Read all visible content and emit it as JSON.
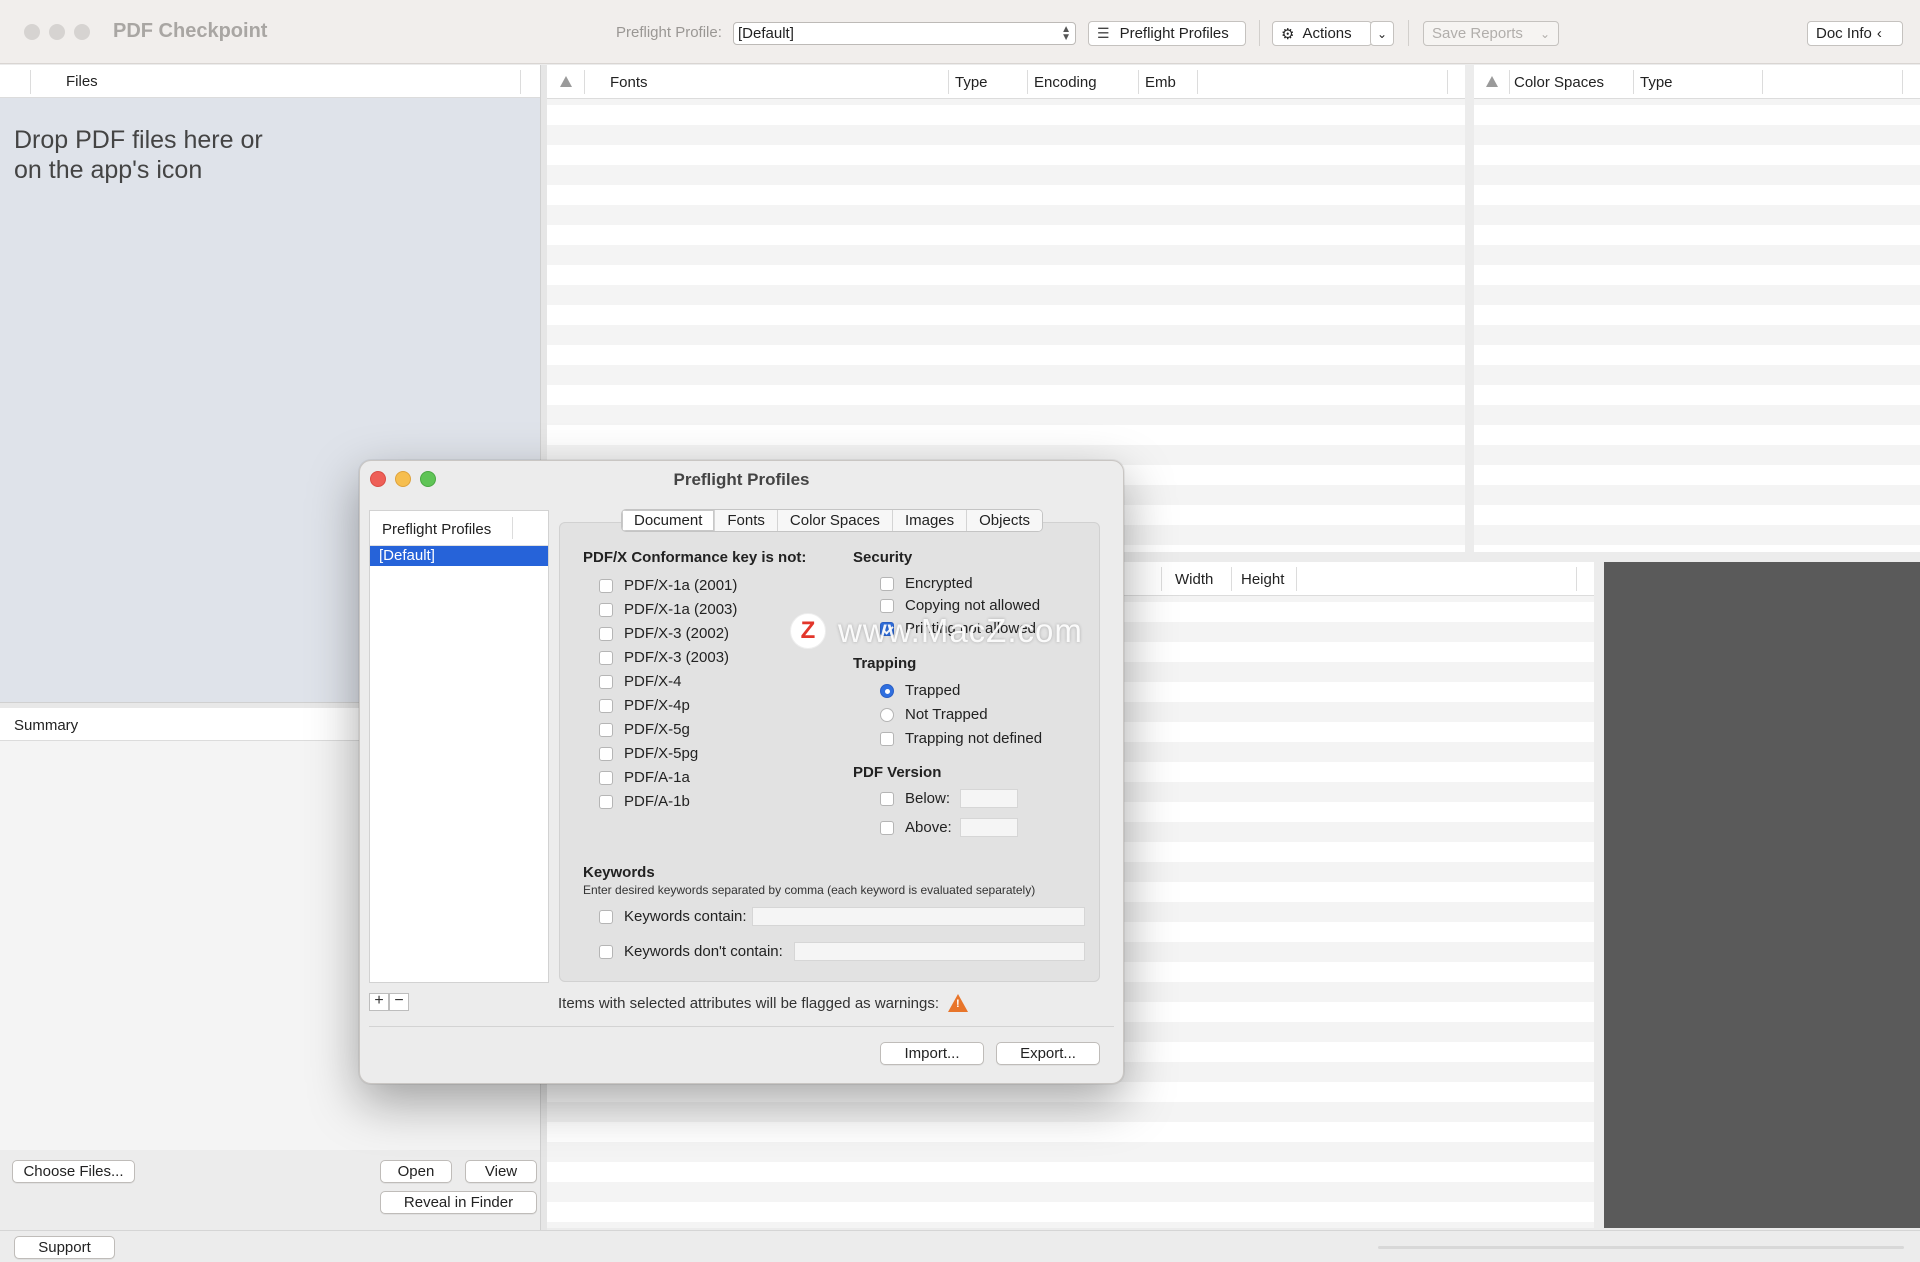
{
  "app": {
    "title": "PDF Checkpoint"
  },
  "toolbar": {
    "profile_label": "Preflight Profile:",
    "profile_value": "[Default]",
    "preflight_profiles_label": "Preflight Profiles",
    "actions_label": "Actions",
    "save_reports_label": "Save Reports",
    "doc_info_label": "Doc Info"
  },
  "files": {
    "header": "Files",
    "drop_line1": "Drop PDF files here or",
    "drop_line2": "on the app's icon"
  },
  "summary": {
    "header": "Summary"
  },
  "left_buttons": {
    "choose_files": "Choose Files...",
    "open": "Open",
    "view": "View",
    "reveal": "Reveal in Finder"
  },
  "fonts_table": {
    "columns": [
      "Fonts",
      "Type",
      "Encoding",
      "Emb"
    ]
  },
  "color_table": {
    "columns": [
      "Color Spaces",
      "Type"
    ]
  },
  "images_table": {
    "columns": [
      "Width",
      "Height"
    ]
  },
  "status": {
    "support_label": "Support"
  },
  "dialog": {
    "title": "Preflight Profiles",
    "list_header": "Preflight Profiles",
    "selected_profile": "[Default]",
    "tabs": [
      "Document",
      "Fonts",
      "Color Spaces",
      "Images",
      "Objects"
    ],
    "conformance_title": "PDF/X Conformance key is not:",
    "conformance": [
      "PDF/X-1a (2001)",
      "PDF/X-1a (2003)",
      "PDF/X-3 (2002)",
      "PDF/X-3 (2003)",
      "PDF/X-4",
      "PDF/X-4p",
      "PDF/X-5g",
      "PDF/X-5pg",
      "PDF/A-1a",
      "PDF/A-1b"
    ],
    "security_title": "Security",
    "security": [
      "Encrypted",
      "Copying not allowed",
      "Printing not allowed"
    ],
    "trapping_title": "Trapping",
    "trapping": [
      "Trapped",
      "Not Trapped",
      "Trapping not defined"
    ],
    "version_title": "PDF Version",
    "version_below": "Below:",
    "version_above": "Above:",
    "keywords_title": "Keywords",
    "keywords_note": "Enter desired keywords separated by comma (each keyword is evaluated separately)",
    "keywords_contain": "Keywords contain:",
    "keywords_not_contain": "Keywords don't contain:",
    "flag_note": "Items with selected attributes will be flagged as warnings:",
    "import_label": "Import...",
    "export_label": "Export..."
  },
  "watermark": {
    "logo_letter": "Z",
    "text": "www.MacZ.com"
  },
  "colors": {
    "accent": "#2663d9",
    "warning": "#e8752a",
    "dark_pane": "#5a5a5a"
  }
}
